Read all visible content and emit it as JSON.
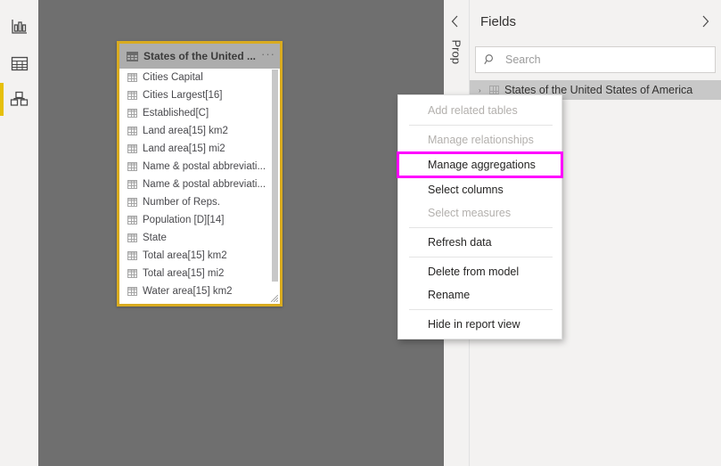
{
  "view_rail": {
    "items": [
      {
        "name": "report-view",
        "icon": "bar-chart-icon",
        "selected": false
      },
      {
        "name": "data-view",
        "icon": "table-grid-icon",
        "selected": false
      },
      {
        "name": "model-view",
        "icon": "model-relationships-icon",
        "selected": true
      }
    ],
    "selected_accent": "#e6c00a"
  },
  "canvas": {
    "background": "#6f6f6f",
    "table_card": {
      "title": "States of the United ...",
      "header_icon": "table-icon",
      "overflow_menu": "···",
      "border_color": "#d9ab1f",
      "selected": true,
      "fields": [
        "Cities Capital",
        "Cities Largest[16]",
        "Established[C]",
        "Land area[15] km2",
        "Land area[15] mi2",
        "Name & postal abbreviati...",
        "Name & postal abbreviati...",
        "Number of Reps.",
        "Population [D][14]",
        "State",
        "Total area[15] km2",
        "Total area[15] mi2",
        "Water area[15] km2"
      ]
    }
  },
  "context_menu": {
    "highlight_color": "#ff00ff",
    "items": [
      {
        "label": "Add related tables",
        "disabled": true,
        "highlighted": false,
        "sep_after": true
      },
      {
        "label": "Manage relationships",
        "disabled": true,
        "highlighted": false,
        "sep_after": false
      },
      {
        "label": "Manage aggregations",
        "disabled": false,
        "highlighted": true,
        "sep_after": false
      },
      {
        "label": "Select columns",
        "disabled": false,
        "highlighted": false,
        "sep_after": false
      },
      {
        "label": "Select measures",
        "disabled": true,
        "highlighted": false,
        "sep_after": true
      },
      {
        "label": "Refresh data",
        "disabled": false,
        "highlighted": false,
        "sep_after": true
      },
      {
        "label": "Delete from model",
        "disabled": false,
        "highlighted": false,
        "sep_after": false
      },
      {
        "label": "Rename",
        "disabled": false,
        "highlighted": false,
        "sep_after": true
      },
      {
        "label": "Hide in report view",
        "disabled": false,
        "highlighted": false,
        "sep_after": false
      }
    ]
  },
  "right_pane": {
    "properties_tab": {
      "label": "Prop",
      "collapse_icon": "chevron-left-icon"
    },
    "fields": {
      "title": "Fields",
      "expand_icon": "chevron-right-icon",
      "search": {
        "placeholder": "Search",
        "value": "",
        "icon": "search-icon"
      },
      "tree": [
        {
          "label": "States of the United States of America",
          "icon": "table-icon",
          "chevron": "›",
          "selected": true
        }
      ]
    }
  }
}
